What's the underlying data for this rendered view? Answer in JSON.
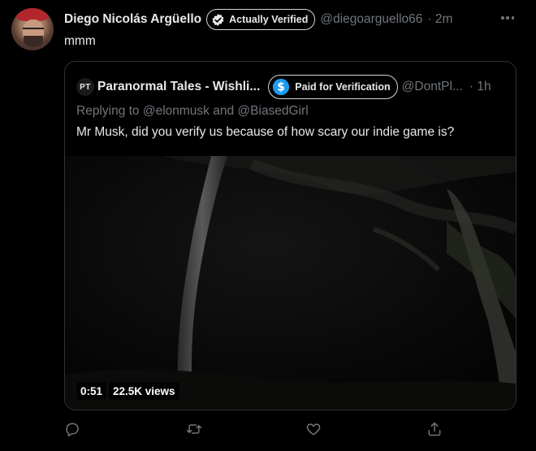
{
  "author": {
    "name": "Diego Nicolás Argüello",
    "badge": "Actually Verified",
    "handle": "@diegoarguello66",
    "time": "· 2m"
  },
  "tweet_text": "mmm",
  "quote": {
    "avatar_text": "PT",
    "name": "Paranormal Tales - Wishli...",
    "badge": "Paid for Verification",
    "handle": "@DontPl...",
    "time": "· 1h",
    "replying_prefix": "Replying to ",
    "mention1": "@elonmusk",
    "and": " and ",
    "mention2": "@BiasedGirl",
    "text": "Mr Musk, did you verify us because of how scary our indie game is?",
    "video": {
      "duration": "0:51",
      "views": "22.5K views"
    }
  },
  "icons": {
    "more": "more-icon",
    "reply": "reply-icon",
    "retweet": "retweet-icon",
    "like": "like-icon",
    "share": "share-icon",
    "verified": "verified-check-icon",
    "dollar": "dollar-coin-icon"
  },
  "colors": {
    "background": "#000000",
    "text": "#e7e9ea",
    "muted": "#71767b",
    "border": "#2f3336",
    "coin": "#1d9bf0"
  }
}
